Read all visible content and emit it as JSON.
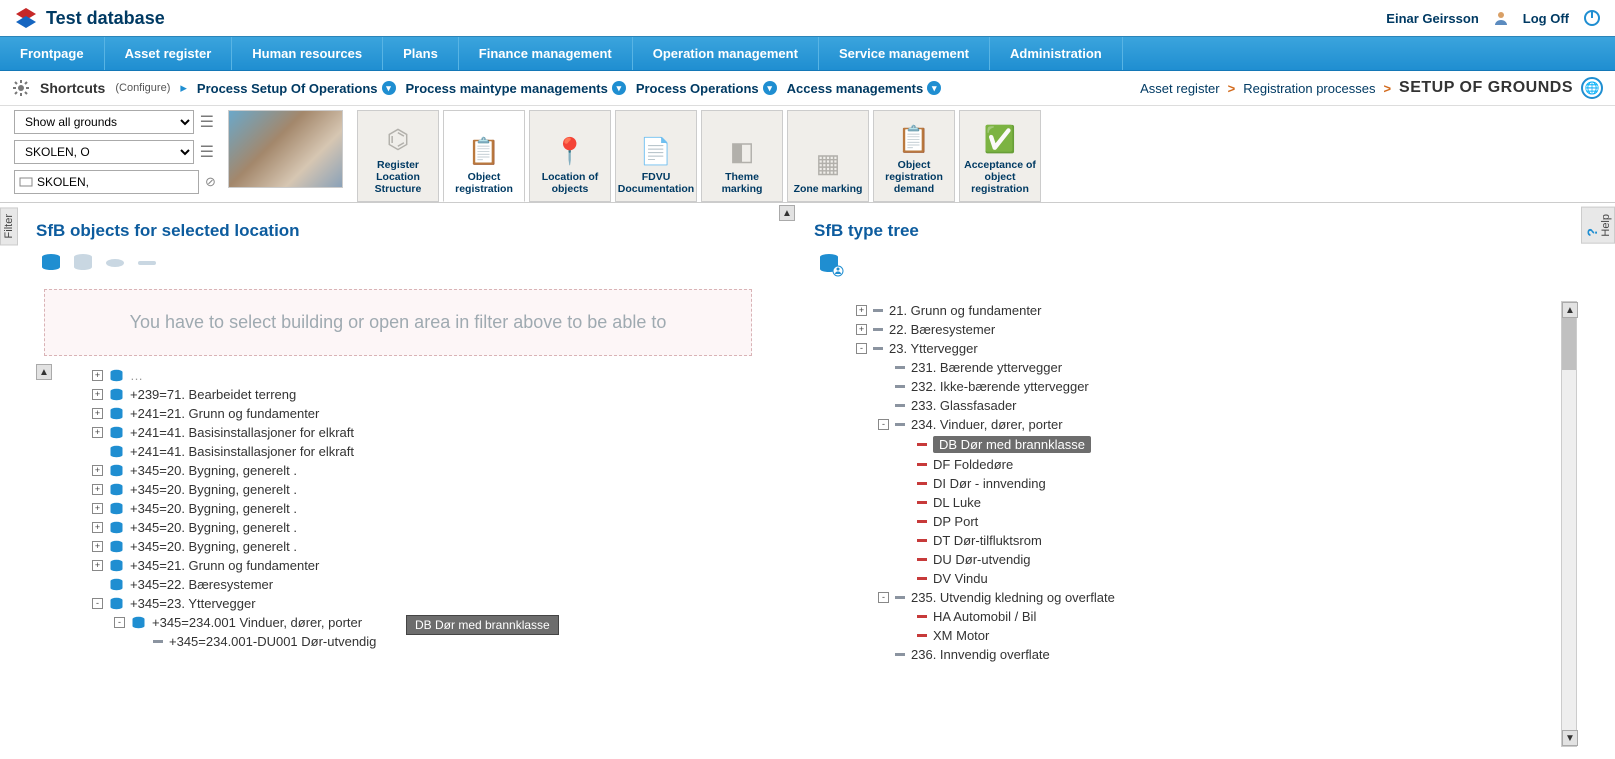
{
  "header": {
    "app_title": "Test database",
    "user_name": "Einar Geirsson",
    "logoff": "Log Off"
  },
  "nav": [
    "Frontpage",
    "Asset register",
    "Human resources",
    "Plans",
    "Finance management",
    "Operation management",
    "Service management",
    "Administration"
  ],
  "subbar": {
    "shortcuts": "Shortcuts",
    "configure": "(Configure)",
    "links": [
      "Process Setup Of Operations",
      "Process maintype managements",
      "Process Operations",
      "Access managements"
    ]
  },
  "breadcrumb": {
    "a": "Asset register",
    "b": "Registration processes",
    "current": "SETUP OF GROUNDS"
  },
  "filters": {
    "f1": "Show all grounds",
    "f2": "SKOLEN, O",
    "f3": "SKOLEN,"
  },
  "cards": [
    {
      "label": "Register Location Structure"
    },
    {
      "label": "Object registration"
    },
    {
      "label": "Location of objects"
    },
    {
      "label": "FDVU Documentation"
    },
    {
      "label": "Theme marking"
    },
    {
      "label": "Zone marking"
    },
    {
      "label": "Object registration demand"
    },
    {
      "label": "Acceptance of object registration"
    }
  ],
  "left": {
    "title": "SfB objects for selected location",
    "notice": "You have to select building or open area in filter above to be able to",
    "drag_label": "DB Dør med brannklasse",
    "nodes": [
      {
        "t": "+239=71. Bearbeidet terreng",
        "exp": "+"
      },
      {
        "t": "+241=21. Grunn og fundamenter",
        "exp": "+"
      },
      {
        "t": "+241=41. Basisinstallasjoner for elkraft",
        "exp": "+"
      },
      {
        "t": "+241=41. Basisinstallasjoner for elkraft",
        "exp": ""
      },
      {
        "t": "+345=20. Bygning, generelt .",
        "exp": "+"
      },
      {
        "t": "+345=20. Bygning, generelt .",
        "exp": "+"
      },
      {
        "t": "+345=20. Bygning, generelt .",
        "exp": "+"
      },
      {
        "t": "+345=20. Bygning, generelt .",
        "exp": "+"
      },
      {
        "t": "+345=20. Bygning, generelt .",
        "exp": "+"
      },
      {
        "t": "+345=21. Grunn og fundamenter",
        "exp": "+"
      },
      {
        "t": "+345=22. Bæresystemer",
        "exp": ""
      },
      {
        "t": "+345=23. Yttervegger",
        "exp": "-",
        "children": [
          {
            "t": "+345=234.001 Vinduer, dører, porter",
            "exp": "-",
            "children": [
              {
                "t": "+345=234.001-DU001 Dør-utvendig",
                "dash": true
              }
            ]
          }
        ]
      }
    ]
  },
  "right": {
    "title": "SfB type tree",
    "nodes": [
      {
        "t": "21. Grunn og fundamenter",
        "exp": "+",
        "dash": "g"
      },
      {
        "t": "22. Bæresystemer",
        "exp": "+",
        "dash": "g"
      },
      {
        "t": "23. Yttervegger",
        "exp": "-",
        "dash": "g",
        "children": [
          {
            "t": "231. Bærende yttervegger",
            "dash": "g"
          },
          {
            "t": "232. Ikke-bærende yttervegger",
            "dash": "g"
          },
          {
            "t": "233. Glassfasader",
            "dash": "g"
          },
          {
            "t": "234. Vinduer, dører, porter",
            "exp": "-",
            "dash": "g",
            "children": [
              {
                "t": "DB Dør med brannklasse",
                "dash": "r",
                "sel": true
              },
              {
                "t": "DF Foldedøre",
                "dash": "r"
              },
              {
                "t": "DI Dør - innvending",
                "dash": "r"
              },
              {
                "t": "DL Luke",
                "dash": "r"
              },
              {
                "t": "DP Port",
                "dash": "r"
              },
              {
                "t": "DT Dør-tilfluktsrom",
                "dash": "r"
              },
              {
                "t": "DU Dør-utvendig",
                "dash": "r"
              },
              {
                "t": "DV Vindu",
                "dash": "r"
              }
            ]
          },
          {
            "t": "235. Utvendig kledning og overflate",
            "exp": "-",
            "dash": "g",
            "children": [
              {
                "t": "HA Automobil / Bil",
                "dash": "r"
              },
              {
                "t": "XM Motor",
                "dash": "r"
              }
            ]
          },
          {
            "t": "236. Innvendig overflate",
            "dash": "g"
          }
        ]
      }
    ]
  },
  "side_tabs": {
    "filter": "Filter",
    "help": "Help"
  }
}
